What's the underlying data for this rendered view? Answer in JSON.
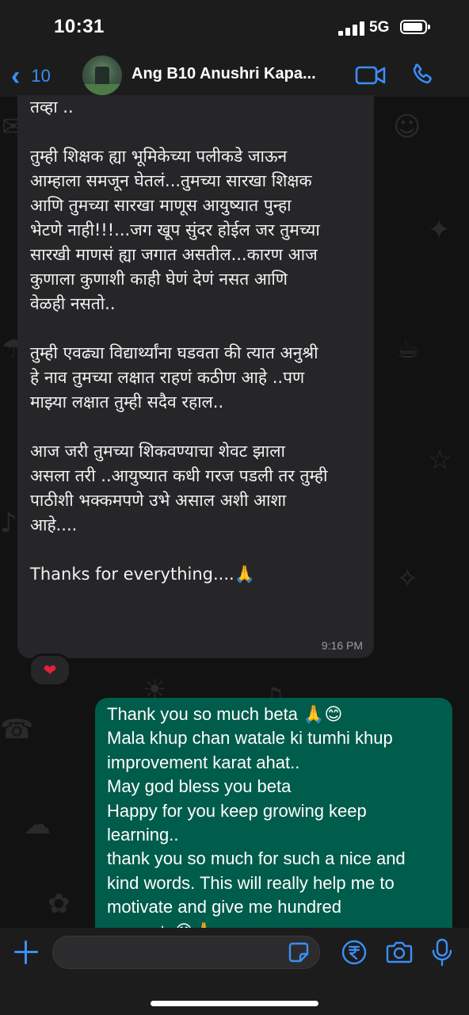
{
  "status_bar": {
    "time": "10:31",
    "network": "5G"
  },
  "header": {
    "back_count": "10",
    "contact_name": "Ang B10 Anushri Kapa...",
    "video_icon": "video-camera-icon",
    "call_icon": "phone-icon"
  },
  "incoming": {
    "lines": [
      "तव्हा ..",
      "",
      "तुम्ही शिक्षक ह्या भूमिकेच्या पलीकडे जाऊन",
      "आम्हाला समजून घेतलं...तुमच्या सारखा शिक्षक",
      "आणि तुमच्या सारखा माणूस आयुष्यात पुन्हा",
      "भेटणे नाही!!!...जग खूप सुंदर होईल जर तुमच्या",
      "सारखी माणसं ह्या जगात असतील...कारण आज",
      "कुणाला कुणाशी काही घेणं देणं नसत आणि",
      "वेळही नसतो..",
      "",
      "तुम्ही एवढ्या विद्यार्थ्यांना घडवता की त्यात अनुश्री",
      "हे नाव तुमच्या लक्षात राहणं कठीण आहे ..पण",
      "माझ्या लक्षात तुम्ही सदैव रहाल..",
      "",
      "आज जरी तुमच्या शिकवण्याचा शेवट झाला",
      "असला तरी ..आयुष्यात कधी गरज पडली तर तुम्ही",
      "पाठीशी भक्कमपणे उभे असाल अशी आशा",
      "आहे....",
      "",
      "Thanks for everything....🙏"
    ],
    "time": "9:16 PM",
    "reaction": "❤"
  },
  "outgoing": {
    "lines": [
      "Thank you so much beta 🙏😊",
      "Mala khup chan watale ki tumhi khup",
      "improvement karat ahat..",
      "May god bless you beta",
      "Happy for you keep growing keep",
      "learning..",
      "thank you so much for such a nice and",
      "kind words. This will really help me to",
      "motivate and give me hundred",
      "percent. 😊🙏"
    ]
  },
  "composer": {
    "input_value": "",
    "icons": [
      "plus-icon",
      "sticker-icon",
      "rupee-icon",
      "camera-icon",
      "microphone-icon"
    ]
  },
  "colors": {
    "accent": "#3b8ff6",
    "incoming_bubble": "#262628",
    "outgoing_bubble": "#005c4b",
    "reaction": "#e5213a"
  }
}
